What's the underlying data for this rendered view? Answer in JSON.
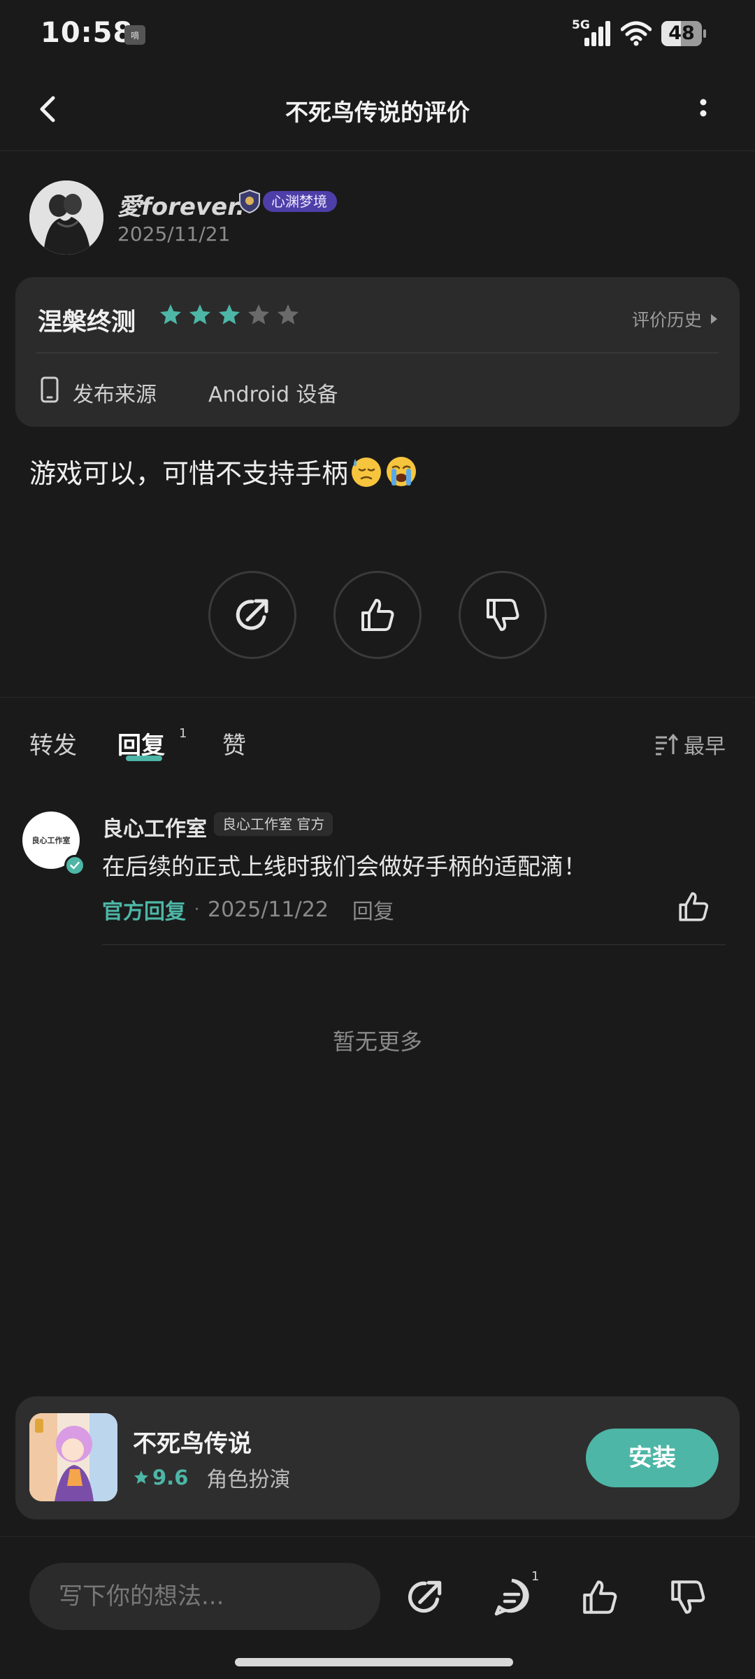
{
  "status_bar": {
    "time": "10:58",
    "small_icon_text": "嘀",
    "network": "5G",
    "battery_level": 48,
    "battery_text": "48"
  },
  "nav": {
    "title": "不死鸟传说的评价",
    "back_icon": "chevron-left-icon",
    "more_icon": "more-vertical-icon"
  },
  "author": {
    "name": "愛forever.",
    "badge": "心渊梦境",
    "date": "2025/11/21"
  },
  "info_card": {
    "game_title": "涅槃终测",
    "rating": 3,
    "max_rating": 5,
    "history_label": "评价历史",
    "source_label": "发布来源",
    "source_value": "Android 设备"
  },
  "review": {
    "text": "游戏可以，可惜不支持手柄",
    "emojis": [
      "downcast-sweat-emoji",
      "loudly-crying-emoji"
    ]
  },
  "tabs": {
    "items": [
      {
        "label": "转发"
      },
      {
        "label": "回复",
        "count": "1"
      },
      {
        "label": "赞"
      }
    ],
    "sort_label": "最早"
  },
  "reply": {
    "avatar_text": "良心工作室",
    "name": "良心工作室",
    "tag": "良心工作室 官方",
    "text": "在后续的正式上线时我们会做好手柄的适配滴！",
    "official_label": "官方回复",
    "separator": "·",
    "date": "2025/11/22",
    "reply_label": "回复"
  },
  "list_end": "暂无更多",
  "app_card": {
    "name": "不死鸟传说",
    "score": "9.6",
    "genre": "角色扮演",
    "install_label": "安装"
  },
  "input_bar": {
    "placeholder": "写下你的想法...",
    "comment_count": "1"
  },
  "colors": {
    "background": "#1a1a1a",
    "card": "#2b2b2b",
    "accent": "#4db6a6",
    "badge": "#4d3ea8",
    "star_off": "#6a6a6a"
  }
}
